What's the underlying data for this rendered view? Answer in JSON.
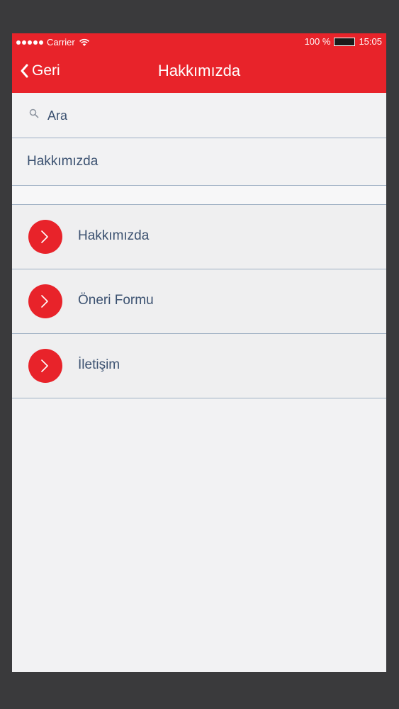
{
  "status_bar": {
    "carrier": "Carrier",
    "battery": "100 %",
    "time": "15:05"
  },
  "nav": {
    "back_label": "Geri",
    "title": "Hakkımızda"
  },
  "search": {
    "placeholder": "Ara"
  },
  "section": {
    "header": "Hakkımızda"
  },
  "list": {
    "items": [
      {
        "label": "Hakkımızda",
        "icon": "chevron-right-icon"
      },
      {
        "label": "Öneri Formu",
        "icon": "chevron-right-icon"
      },
      {
        "label": "İletişim",
        "icon": "chevron-right-icon"
      }
    ]
  },
  "colors": {
    "accent": "#e8232a",
    "text": "#3b5170",
    "divider": "#9fb0c4",
    "background": "#f2f2f3"
  }
}
